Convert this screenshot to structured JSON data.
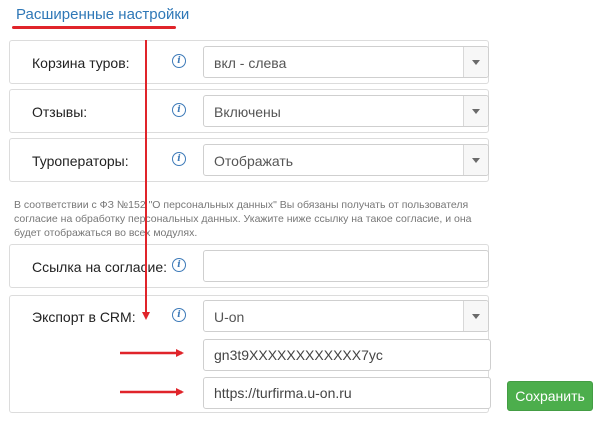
{
  "header": {
    "title": "Расширенные настройки"
  },
  "settings": {
    "cart": {
      "label": "Корзина туров:",
      "value": "вкл - слева"
    },
    "reviews": {
      "label": "Отзывы:",
      "value": "Включены"
    },
    "operators": {
      "label": "Туроператоры:",
      "value": "Отображать"
    }
  },
  "notice": "В соответствии с ФЗ №152 \"О персональных данных\" Вы обязаны получать от пользователя согласие на обработку персональных данных. Укажите ниже ссылку на такое согласие, и она будет отображаться во всех модулях.",
  "consent": {
    "label": "Ссылка на согласие:",
    "value": ""
  },
  "crm": {
    "label": "Экспорт в CRM:",
    "value": "U-on",
    "key_value": "gn3t9XXXXXXXXXXXX7yc",
    "url_value": "https://turfirma.u-on.ru"
  },
  "save_label": "Сохранить",
  "colors": {
    "link": "#2f78b7",
    "annotation": "#e0242a",
    "save": "#4cae4c"
  },
  "icons": {
    "info": "info-icon",
    "caret": "chevron-down-icon"
  }
}
